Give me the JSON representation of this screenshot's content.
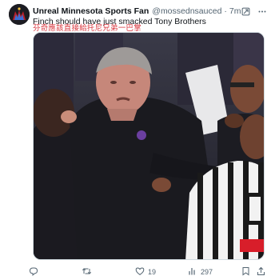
{
  "author": {
    "name": "Unreal Minnesota Sports Fan",
    "handle": "@mossednsauced",
    "separator": "·",
    "time": "7m"
  },
  "tweet": {
    "text": "Finch should have just smacked Tony Brothers",
    "caption": "芬奇應該直接給托尼兄弟一巴掌"
  },
  "actions": {
    "replies": "",
    "reposts": "",
    "likes": "19",
    "views": "297"
  },
  "icons": {
    "verified": "verified-badge-icon",
    "grok": "grok-icon",
    "more": "more-icon",
    "reply": "reply-icon",
    "repost": "repost-icon",
    "like": "heart-icon",
    "views": "views-icon",
    "bookmark": "bookmark-icon",
    "share": "share-icon"
  },
  "colors": {
    "verified": "#1d9bf0",
    "caption": "#d9363e",
    "secondary_text": "#536471"
  }
}
